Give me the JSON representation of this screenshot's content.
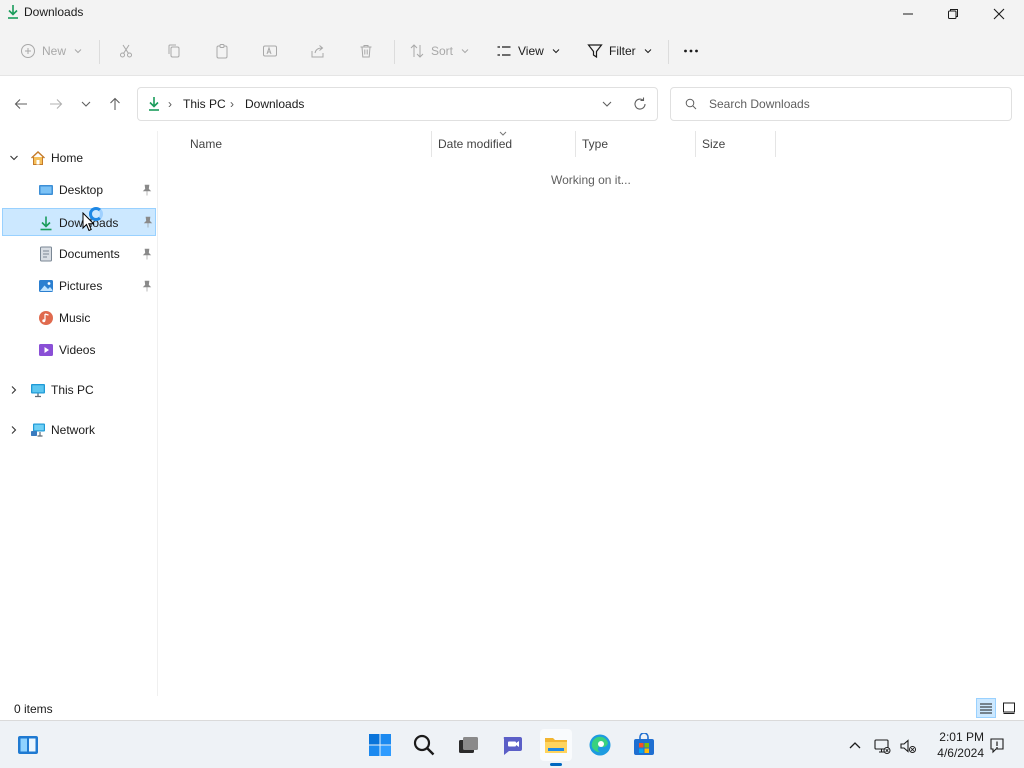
{
  "window": {
    "title": "Downloads"
  },
  "commandbar": {
    "new_label": "New",
    "sort_label": "Sort",
    "view_label": "View",
    "filter_label": "Filter"
  },
  "address": {
    "crumbs": [
      "This PC",
      "Downloads"
    ],
    "search_placeholder": "Search Downloads"
  },
  "navpane": {
    "home": "Home",
    "quick_access": [
      {
        "label": "Desktop",
        "icon": "desktop-icon",
        "pinned": true
      },
      {
        "label": "Downloads",
        "icon": "downloads-icon",
        "pinned": true,
        "selected": true
      },
      {
        "label": "Documents",
        "icon": "documents-icon",
        "pinned": true
      },
      {
        "label": "Pictures",
        "icon": "pictures-icon",
        "pinned": true
      },
      {
        "label": "Music",
        "icon": "music-icon",
        "pinned": false
      },
      {
        "label": "Videos",
        "icon": "videos-icon",
        "pinned": false
      }
    ],
    "this_pc": "This PC",
    "network": "Network"
  },
  "content": {
    "columns": [
      "Name",
      "Date modified",
      "Type",
      "Size"
    ],
    "empty_message": "Working on it..."
  },
  "statusbar": {
    "item_count": "0 items"
  },
  "taskbar": {
    "time": "2:01 PM",
    "date": "4/6/2024"
  },
  "colors": {
    "accent": "#0067c0",
    "selection_bg": "#cce8ff",
    "selection_border": "#99d1ff",
    "download_green": "#1a9c5b"
  }
}
